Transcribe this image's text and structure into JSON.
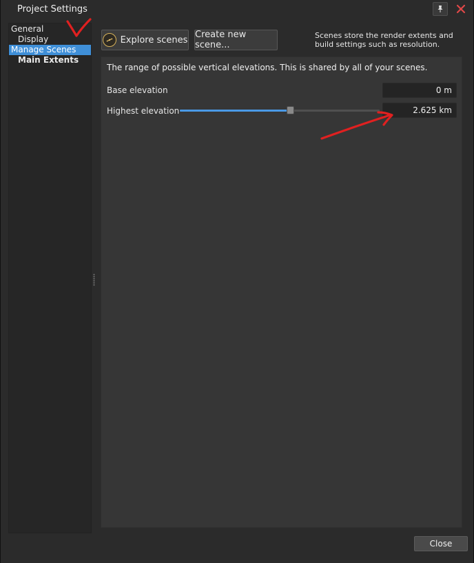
{
  "window": {
    "title": "Project Settings",
    "pin_icon": "pin-icon",
    "close_icon": "close-icon",
    "accent": "#3f8fd8",
    "close_color": "#e04848"
  },
  "sidebar": {
    "items": [
      {
        "label": "General",
        "level": 0,
        "selected": false,
        "bold": false
      },
      {
        "label": "Display",
        "level": 1,
        "selected": false,
        "bold": false
      },
      {
        "label": "Manage Scenes",
        "level": 0,
        "selected": true,
        "bold": false
      },
      {
        "label": "Main Extents",
        "level": 1,
        "selected": false,
        "bold": true
      }
    ]
  },
  "toolbar": {
    "explore_label": "Explore scenes",
    "explore_icon": "compass-icon",
    "create_label": "Create new scene...",
    "info_text": "Scenes store the render extents and build settings such as resolution."
  },
  "panel": {
    "description": "The range of possible vertical elevations. This is shared by all of your scenes.",
    "base_label": "Base elevation",
    "base_value": "0 m",
    "highest_label": "Highest elevation",
    "highest_value": "2.625 km",
    "slider_fraction": 0.55
  },
  "footer": {
    "close_label": "Close"
  },
  "annotations": {
    "color": "#e02020"
  }
}
